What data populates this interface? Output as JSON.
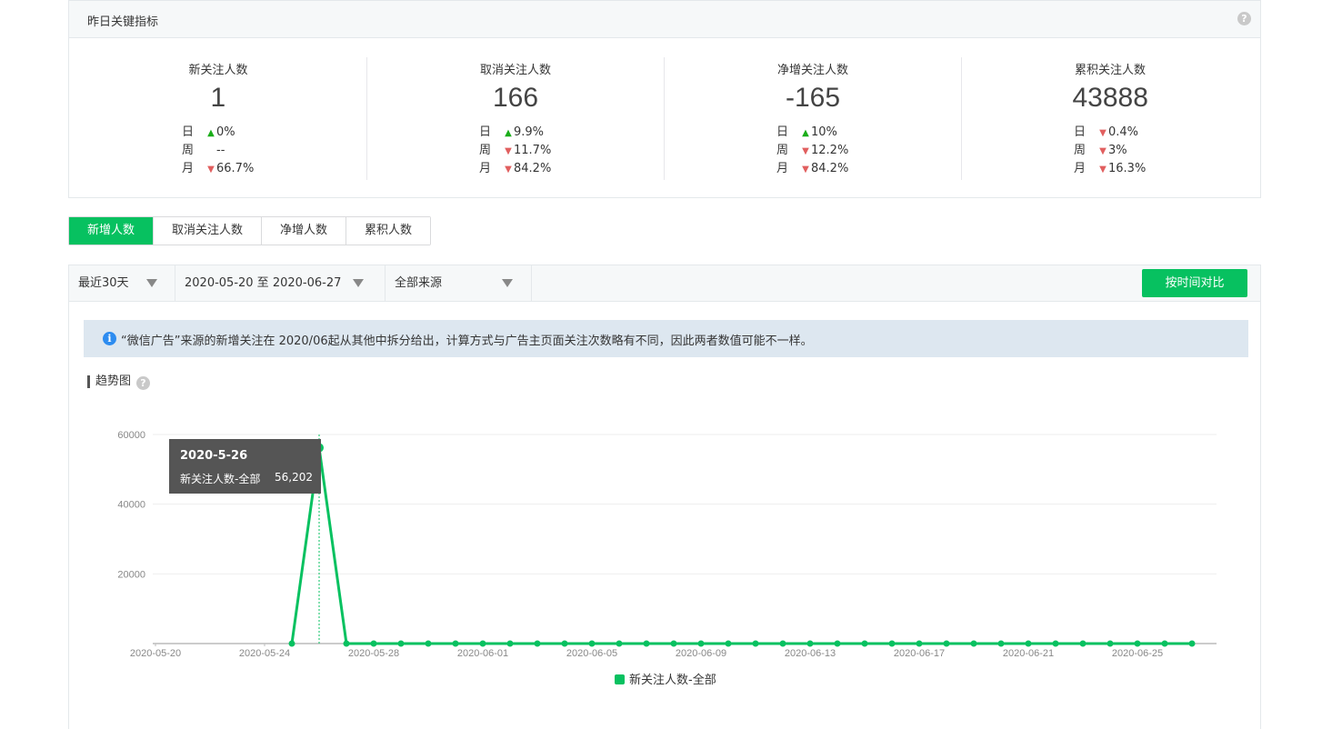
{
  "panel": {
    "title": "昨日关键指标"
  },
  "metrics": [
    {
      "label": "新关注人数",
      "value": "1",
      "rows": [
        {
          "k": "日",
          "dir": "up",
          "pct": "0%"
        },
        {
          "k": "周",
          "dir": "none",
          "pct": "--"
        },
        {
          "k": "月",
          "dir": "down",
          "pct": "66.7%"
        }
      ]
    },
    {
      "label": "取消关注人数",
      "value": "166",
      "rows": [
        {
          "k": "日",
          "dir": "up",
          "pct": "9.9%"
        },
        {
          "k": "周",
          "dir": "down",
          "pct": "11.7%"
        },
        {
          "k": "月",
          "dir": "down",
          "pct": "84.2%"
        }
      ]
    },
    {
      "label": "净增关注人数",
      "value": "-165",
      "rows": [
        {
          "k": "日",
          "dir": "up",
          "pct": "10%"
        },
        {
          "k": "周",
          "dir": "down",
          "pct": "12.2%"
        },
        {
          "k": "月",
          "dir": "down",
          "pct": "84.2%"
        }
      ]
    },
    {
      "label": "累积关注人数",
      "value": "43888",
      "rows": [
        {
          "k": "日",
          "dir": "down",
          "pct": "0.4%"
        },
        {
          "k": "周",
          "dir": "down",
          "pct": "3%"
        },
        {
          "k": "月",
          "dir": "down",
          "pct": "16.3%"
        }
      ]
    }
  ],
  "tabs": [
    "新增人数",
    "取消关注人数",
    "净增人数",
    "累积人数"
  ],
  "filters": {
    "period": "最近30天",
    "range": "2020-05-20 至 2020-06-27",
    "source": "全部来源",
    "compare_button": "按时间对比"
  },
  "notice": "“微信广告”来源的新增关注在 2020/06起从其他中拆分给出，计算方式与广告主页面关注次数略有不同，因此两者数值可能不一样。",
  "trend": {
    "title": "趋势图"
  },
  "tooltip": {
    "date": "2020-5-26",
    "series": "新关注人数-全部",
    "value": "56,202"
  },
  "colors": {
    "accent": "#07c160",
    "up": "#1aad19",
    "down": "#e15f5f"
  },
  "chart_data": {
    "type": "line",
    "start_date": "2020-05-20",
    "end_date": "2020-06-27",
    "x_ticks": [
      "2020-05-20",
      "2020-05-24",
      "2020-05-28",
      "2020-06-01",
      "2020-06-05",
      "2020-06-09",
      "2020-06-13",
      "2020-06-17",
      "2020-06-21",
      "2020-06-25"
    ],
    "y_ticks": [
      20000,
      40000,
      60000
    ],
    "ylim": [
      0,
      60000
    ],
    "series": [
      {
        "name": "新关注人数-全部",
        "points": [
          {
            "x": "2020-05-25",
            "y": 0
          },
          {
            "x": "2020-05-26",
            "y": 56202
          },
          {
            "x": "2020-05-27",
            "y": 0
          },
          {
            "x": "2020-05-28",
            "y": 0
          },
          {
            "x": "2020-05-29",
            "y": 0
          },
          {
            "x": "2020-05-30",
            "y": 0
          },
          {
            "x": "2020-05-31",
            "y": 0
          },
          {
            "x": "2020-06-01",
            "y": 0
          },
          {
            "x": "2020-06-02",
            "y": 0
          },
          {
            "x": "2020-06-03",
            "y": 0
          },
          {
            "x": "2020-06-04",
            "y": 0
          },
          {
            "x": "2020-06-05",
            "y": 0
          },
          {
            "x": "2020-06-06",
            "y": 0
          },
          {
            "x": "2020-06-07",
            "y": 0
          },
          {
            "x": "2020-06-08",
            "y": 0
          },
          {
            "x": "2020-06-09",
            "y": 0
          },
          {
            "x": "2020-06-10",
            "y": 0
          },
          {
            "x": "2020-06-11",
            "y": 0
          },
          {
            "x": "2020-06-12",
            "y": 0
          },
          {
            "x": "2020-06-13",
            "y": 0
          },
          {
            "x": "2020-06-14",
            "y": 0
          },
          {
            "x": "2020-06-15",
            "y": 0
          },
          {
            "x": "2020-06-16",
            "y": 0
          },
          {
            "x": "2020-06-17",
            "y": 0
          },
          {
            "x": "2020-06-18",
            "y": 0
          },
          {
            "x": "2020-06-19",
            "y": 0
          },
          {
            "x": "2020-06-20",
            "y": 0
          },
          {
            "x": "2020-06-21",
            "y": 0
          },
          {
            "x": "2020-06-22",
            "y": 0
          },
          {
            "x": "2020-06-23",
            "y": 0
          },
          {
            "x": "2020-06-24",
            "y": 0
          },
          {
            "x": "2020-06-25",
            "y": 0
          },
          {
            "x": "2020-06-26",
            "y": 0
          },
          {
            "x": "2020-06-27",
            "y": 1
          }
        ]
      }
    ],
    "legend": [
      "新关注人数-全部"
    ],
    "grid": true
  }
}
